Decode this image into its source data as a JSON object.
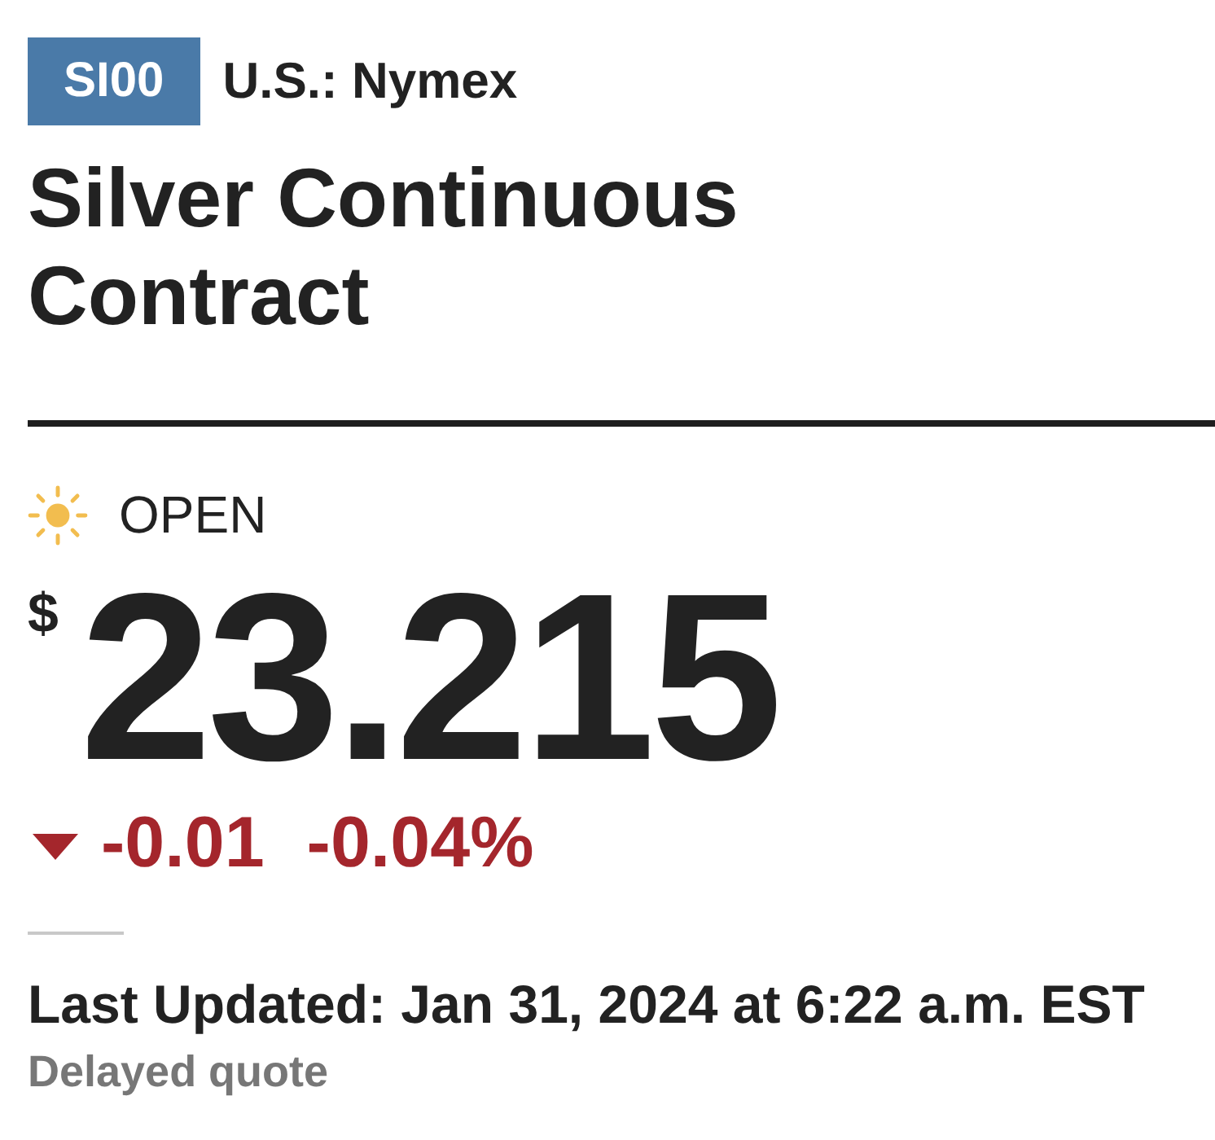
{
  "ticker": {
    "symbol": "SI00",
    "exchange": "U.S.: Nymex"
  },
  "title": "Silver Continuous Contract",
  "market_status": {
    "label": "OPEN",
    "open": true
  },
  "quote": {
    "currency": "$",
    "price": "23.215"
  },
  "change": {
    "down": true,
    "points": "-0.01",
    "percent": "-0.04%"
  },
  "timestamp": "Last Updated: Jan 31, 2024 at 6:22 a.m. EST",
  "note": "Delayed quote"
}
